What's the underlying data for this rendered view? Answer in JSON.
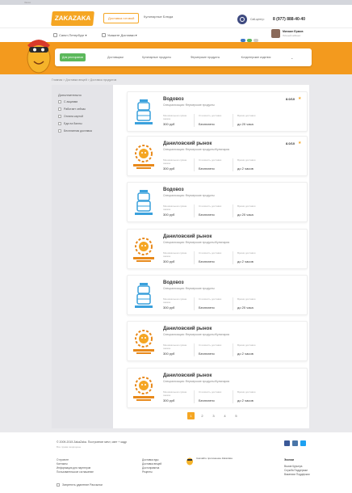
{
  "browser_title": "Заказ",
  "header": {
    "logo": "ZAKAZAKA",
    "tabs": [
      "Доставка готовой",
      "Кулинарные Блюда"
    ],
    "help_label": "Call-центр:",
    "phone": "8 (977) 888-40-40"
  },
  "subheader": {
    "city": "Санкт-Петербург",
    "address": "Укажите Доставки",
    "user_name": "Михаил Ермов",
    "user_sub": "Личный кабинет"
  },
  "categories": [
    "Для ресторанов",
    "Доставщики",
    "Кулинарные продукты",
    "Фермерские продукты",
    "Кондитерские изделия"
  ],
  "breadcrumb": "Главная  >  Доставка вещей  >  Доставка продуктов",
  "filters": {
    "title": "Дополнительно",
    "items": [
      "С акциями",
      "Работает сейчас",
      "Оплата картой",
      "Еда на баллы",
      "Бесплатная доставка"
    ]
  },
  "card_labels": {
    "min_order": "Минимальная сумма заказа",
    "delivery": "Стоимость доставки",
    "time": "Время доставки"
  },
  "vendors": [
    {
      "name": "Водовоз",
      "spec": "Специализация: Фермерские продукты",
      "min": "300 руб",
      "delivery": "Бесплатно",
      "time": "до 20 часа",
      "rating": "8.0/10",
      "logo": "water-logo"
    },
    {
      "name": "Даниловский рынок",
      "spec": "Специализация: Фермерские продукты/Кулинария",
      "min": "300 руб",
      "delivery": "Бесплатно",
      "time": "до 2 часов",
      "rating": "8.0/10",
      "logo": "market-logo"
    },
    {
      "name": "Водовоз",
      "spec": "Специализация: Фермерские продукты",
      "min": "300 руб",
      "delivery": "Бесплатно",
      "time": "до 20 часа",
      "rating": "",
      "logo": "water-logo"
    },
    {
      "name": "Даниловский рынок",
      "spec": "Специализация: Фермерские продукты/Кулинария",
      "min": "300 руб",
      "delivery": "Бесплатно",
      "time": "до 2 часов",
      "rating": "",
      "logo": "market-logo"
    },
    {
      "name": "Водовоз",
      "spec": "Специализация: Фермерские продукты",
      "min": "300 руб",
      "delivery": "Бесплатно",
      "time": "до 20 часа",
      "rating": "",
      "logo": "water-logo"
    },
    {
      "name": "Даниловский рынок",
      "spec": "Специализация: Фермерские продукты/Кулинария",
      "min": "300 руб",
      "delivery": "Бесплатно",
      "time": "до 2 часов",
      "rating": "",
      "logo": "market-logo"
    },
    {
      "name": "Даниловский рынок",
      "spec": "Специализация: Фермерские продукты/Кулинария",
      "min": "300 руб",
      "delivery": "Бесплатно",
      "time": "до 2 часов",
      "rating": "",
      "logo": "market-logo"
    }
  ],
  "pagination": [
    "1",
    "2",
    "3",
    "4",
    "5"
  ],
  "pagination_active": 0,
  "footer": {
    "copyright": "© 2009-2015 ZakaZaka. Построение мечт, свет + кадр",
    "copyright_sub": "Все права защищены",
    "col1": [
      "О проекте",
      "Контакты",
      "Информация для партнеров",
      "Пользовательское соглашение"
    ],
    "col2": [
      "Доставка еды",
      "Доставка вещей",
      "Достопримеча",
      "Рецепты"
    ],
    "app_text": "Скачайте приложение Zakazaka",
    "right_title": "Эконом",
    "col3": [
      "Вызов Курьера",
      "Служба Поддержки",
      "Вакансии Поддержки"
    ],
    "subscribe": "Запретить удаление Рассылки"
  },
  "colors": {
    "brand": "#f39a1e",
    "accent": "#5cb85c",
    "nav": "#3e4a80"
  }
}
